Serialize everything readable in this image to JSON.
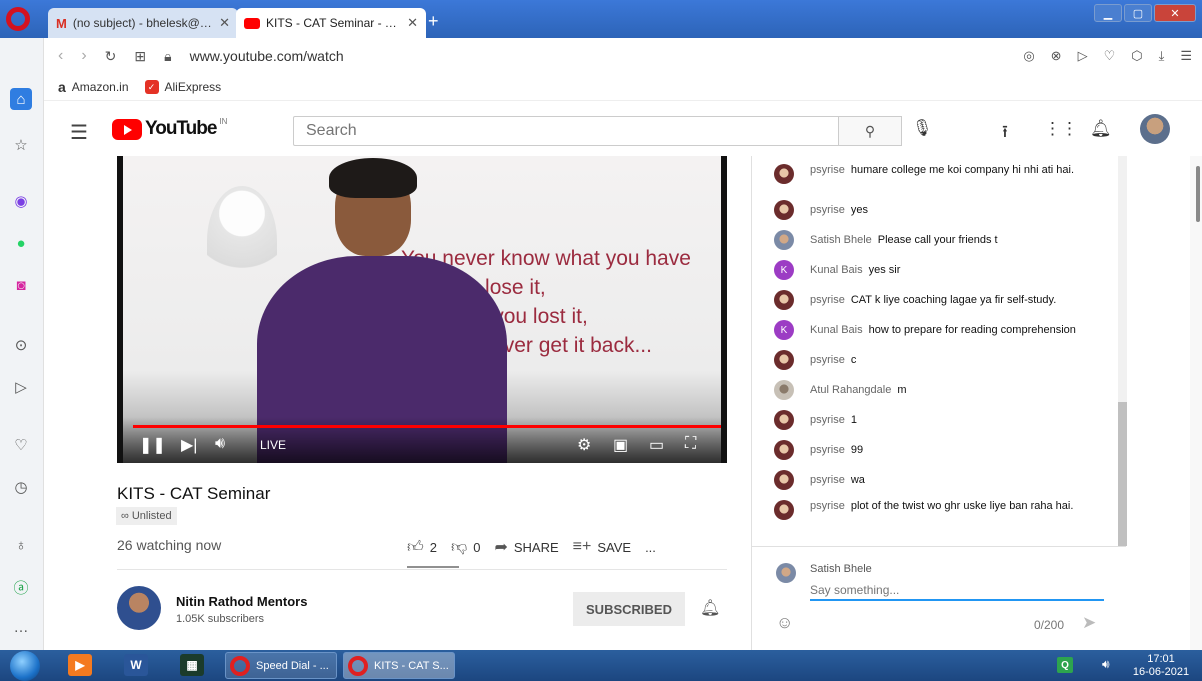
{
  "browser": {
    "tabs": [
      {
        "label": "(no subject) - bhelesk@gm",
        "icon": "gmail-icon"
      },
      {
        "label": "KITS - CAT Seminar - YouTu",
        "icon": "youtube-icon"
      }
    ],
    "new_tab": "+",
    "url": "www.youtube.com/watch",
    "bookmarks": [
      {
        "label": "Amazon.in",
        "icon": "amazon-icon"
      },
      {
        "label": "AliExpress",
        "icon": "aliexpress-icon"
      }
    ]
  },
  "youtube": {
    "logo_text": "YouTube",
    "country": "IN",
    "search_placeholder": "Search"
  },
  "video": {
    "quote_lines": [
      "You never know what you have",
      "until you lose it,",
      "and once you lost it,",
      "you can never get it back..."
    ],
    "live_label": "LIVE",
    "progress": 1.0,
    "title": "KITS - CAT Seminar",
    "visibility": "Unlisted",
    "watching": "26 watching now",
    "likes": "2",
    "dislikes": "0",
    "share_label": "SHARE",
    "save_label": "SAVE",
    "more": "..."
  },
  "channel": {
    "name": "Nitin Rathod Mentors",
    "subscribers": "1.05K subscribers",
    "subscribe_label": "SUBSCRIBED"
  },
  "chat": {
    "messages": [
      {
        "author": "psyrise",
        "text": "humare college me koi company hi nhi ati hai.",
        "avatar": "psyrise"
      },
      {
        "author": "psyrise",
        "text": "yes",
        "avatar": "psyrise"
      },
      {
        "author": "Satish Bhele",
        "text": "Please call your friends t",
        "avatar": "satish"
      },
      {
        "author": "Kunal Bais",
        "text": "yes sir",
        "avatar": "kunal",
        "initial": "K"
      },
      {
        "author": "psyrise",
        "text": "CAT k liye coaching lagae ya fir self-study.",
        "avatar": "psyrise"
      },
      {
        "author": "Kunal Bais",
        "text": "how to prepare for reading comprehension",
        "avatar": "kunal",
        "initial": "K"
      },
      {
        "author": "psyrise",
        "text": "c",
        "avatar": "psyrise"
      },
      {
        "author": "Atul Rahangdale",
        "text": "m",
        "avatar": "atul"
      },
      {
        "author": "psyrise",
        "text": "1",
        "avatar": "psyrise"
      },
      {
        "author": "psyrise",
        "text": "99",
        "avatar": "psyrise"
      },
      {
        "author": "psyrise",
        "text": "wa",
        "avatar": "psyrise"
      },
      {
        "author": "psyrise",
        "text": "plot of the twist wo ghr uske liye ban raha hai.",
        "avatar": "psyrise"
      }
    ],
    "input": {
      "user_name": "Satish Bhele",
      "placeholder": "Say something...",
      "counter": "0/200"
    }
  },
  "taskbar": {
    "tasks": [
      {
        "label": "Speed Dial - ..."
      },
      {
        "label": "KITS - CAT S..."
      }
    ],
    "time": "17:01",
    "date": "16-06-2021"
  },
  "colors": {
    "youtube_red": "#ff0000",
    "accent_blue": "#2196f3",
    "opera_red": "#d3121f"
  }
}
